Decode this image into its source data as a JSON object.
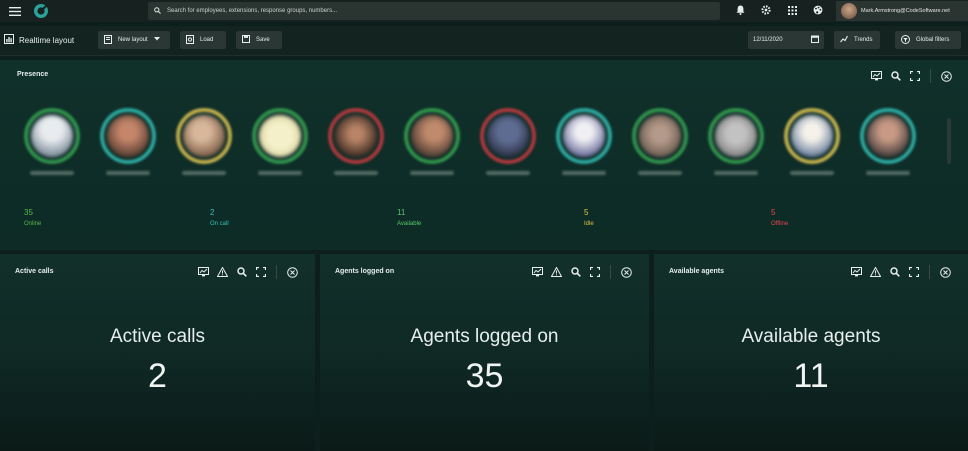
{
  "search": {
    "placeholder": "Search for employees, extensions, response groups, numbers..."
  },
  "user": {
    "email": "Mark.Armstrong@CodeSoftware.net"
  },
  "toolbar": {
    "title": "Realtime layout",
    "new_layout": "New layout",
    "load": "Load",
    "save": "Save",
    "date": "12/11/2020",
    "trends": "Trends",
    "global_filters": "Global filters"
  },
  "presence": {
    "title": "Presence",
    "stats": [
      {
        "value": "35",
        "label": "Online",
        "color": "#57b84d"
      },
      {
        "value": "2",
        "label": "On call",
        "color": "#34c1b5"
      },
      {
        "value": "11",
        "label": "Available",
        "color": "#57c96a"
      },
      {
        "value": "5",
        "label": "Idle",
        "color": "#d9c441"
      },
      {
        "value": "5",
        "label": "Offline",
        "color": "#e0484c"
      }
    ]
  },
  "cards": [
    {
      "title": "Active calls",
      "label": "Active calls",
      "value": "2"
    },
    {
      "title": "Agents logged on",
      "label": "Agents logged on",
      "value": "35"
    },
    {
      "title": "Available agents",
      "label": "Available agents",
      "value": "11"
    }
  ],
  "colors": {
    "accent": "#2aa39a",
    "background": "#0d1f1c"
  }
}
